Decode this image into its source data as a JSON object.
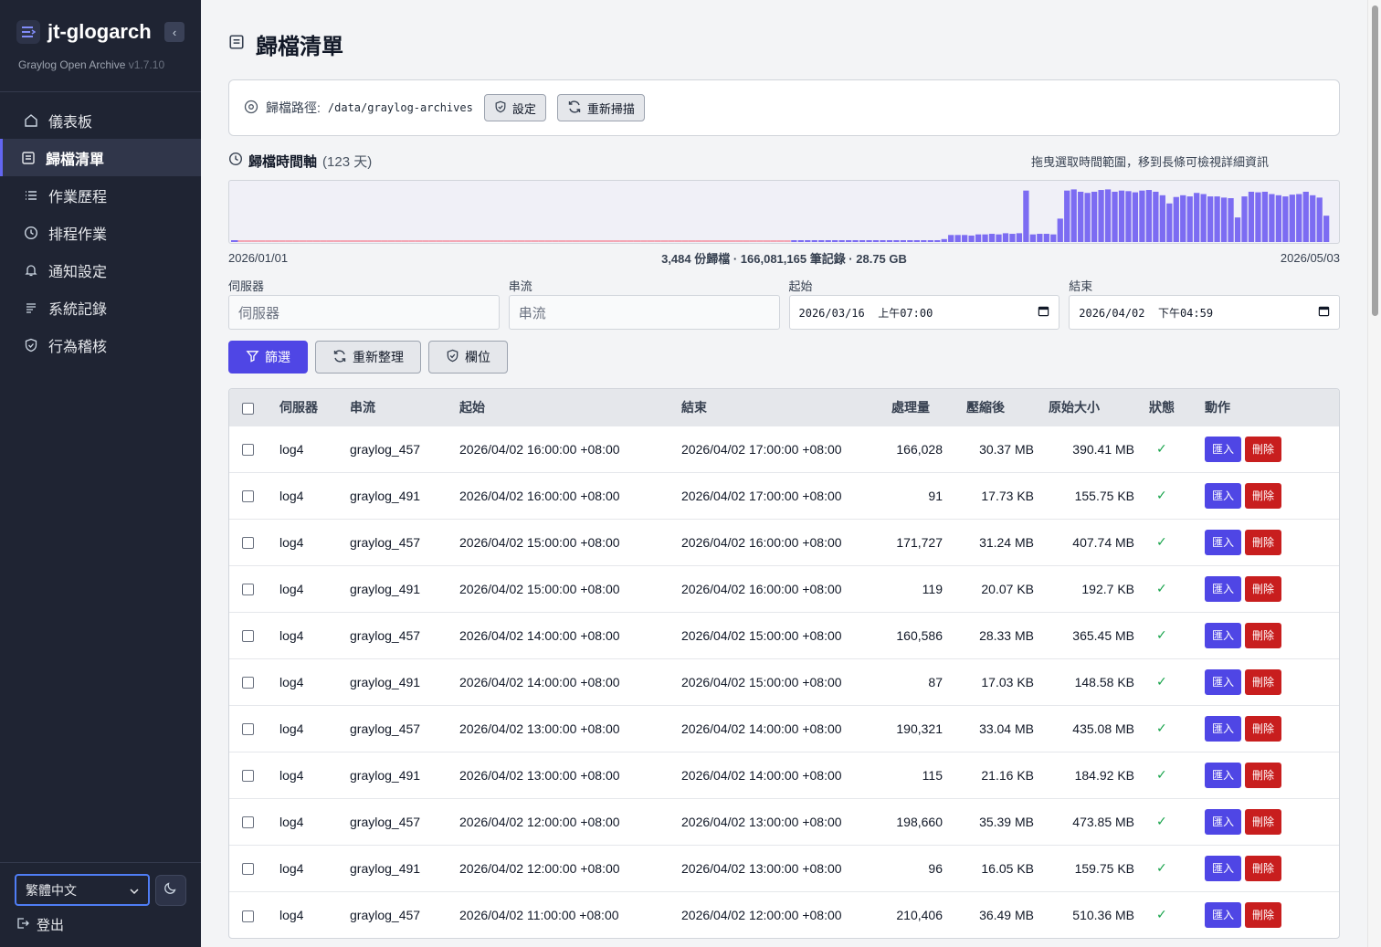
{
  "app": {
    "name": "jt-glogarch",
    "subtitle": "Graylog Open Archive",
    "version": "v1.7.10"
  },
  "sidebar": {
    "items": [
      {
        "label": "儀表板",
        "icon": "home-icon"
      },
      {
        "label": "歸檔清單",
        "icon": "archive-icon",
        "active": true
      },
      {
        "label": "作業歷程",
        "icon": "list-icon"
      },
      {
        "label": "排程作業",
        "icon": "clock-icon"
      },
      {
        "label": "通知設定",
        "icon": "bell-icon"
      },
      {
        "label": "系統記錄",
        "icon": "lines-icon"
      },
      {
        "label": "行為稽核",
        "icon": "shield-icon"
      }
    ],
    "language": "繁體中文",
    "logout": "登出"
  },
  "page": {
    "title": "歸檔清單"
  },
  "path_bar": {
    "label": "歸檔路徑:",
    "path": "/data/graylog-archives",
    "settings_btn": "設定",
    "rescan_btn": "重新掃描"
  },
  "timeline": {
    "title": "歸檔時間軸",
    "days": "(123 天)",
    "hint": "拖曳選取時間範圍，移到長條可檢視詳細資訊",
    "start_date": "2026/01/01",
    "end_date": "2026/05/03",
    "summary": "3,484 份歸檔 · 166,081,165 筆記錄 · 28.75 GB",
    "bar_color": "#7c6cf2",
    "empty_color": "#f4a6b4"
  },
  "chart_data": {
    "type": "bar",
    "x_range": [
      "2026/01/01",
      "2026/05/03"
    ],
    "values": [
      1,
      1,
      1,
      1,
      1,
      1,
      1,
      1,
      1,
      1,
      1,
      1,
      1,
      1,
      1,
      1,
      1,
      1,
      1,
      1,
      1,
      1,
      1,
      1,
      1,
      1,
      1,
      1,
      1,
      1,
      1,
      1,
      1,
      1,
      1,
      1,
      1,
      1,
      1,
      1,
      1,
      1,
      1,
      1,
      1,
      1,
      1,
      1,
      1,
      1,
      1,
      1,
      1,
      1,
      1,
      1,
      1,
      1,
      1,
      1,
      1,
      1,
      1,
      1,
      1,
      1,
      1,
      1,
      1,
      1,
      1,
      1,
      1,
      1,
      1,
      1,
      1,
      1,
      1,
      1,
      1,
      1,
      3,
      3,
      3,
      3,
      3,
      3,
      3,
      3,
      3,
      3,
      3,
      3,
      3,
      3,
      3,
      3,
      3,
      3,
      3,
      3,
      3,
      3,
      5,
      12,
      12,
      12,
      11,
      13,
      13,
      14,
      13,
      15,
      14,
      15,
      88,
      13,
      14,
      14,
      13,
      40,
      88,
      90,
      86,
      84,
      86,
      89,
      90,
      86,
      88,
      87,
      85,
      88,
      89,
      86,
      80,
      66,
      77,
      80,
      78,
      84,
      82,
      78,
      78,
      76,
      75,
      42,
      78,
      86,
      85,
      86,
      82,
      80,
      78,
      81,
      82,
      86,
      80,
      76,
      45
    ],
    "ylim": [
      0,
      100
    ]
  },
  "filters": {
    "server": {
      "label": "伺服器",
      "placeholder": "伺服器"
    },
    "stream": {
      "label": "串流",
      "placeholder": "串流"
    },
    "start": {
      "label": "起始",
      "value": "2026/03/16  上午07:00"
    },
    "end": {
      "label": "結束",
      "value": "2026/04/02  下午04:59"
    }
  },
  "buttons": {
    "filter": "篩選",
    "refresh": "重新整理",
    "columns": "欄位"
  },
  "table": {
    "headers": [
      "伺服器",
      "串流",
      "起始",
      "結束",
      "處理量",
      "壓縮後",
      "原始大小",
      "狀態",
      "動作"
    ],
    "import_label": "匯入",
    "delete_label": "刪除",
    "status_ok": "✓",
    "rows": [
      [
        "log4",
        "graylog_457",
        "2026/04/02 16:00:00 +08:00",
        "2026/04/02 17:00:00 +08:00",
        "166,028",
        "30.37 MB",
        "390.41 MB"
      ],
      [
        "log4",
        "graylog_491",
        "2026/04/02 16:00:00 +08:00",
        "2026/04/02 17:00:00 +08:00",
        "91",
        "17.73 KB",
        "155.75 KB"
      ],
      [
        "log4",
        "graylog_457",
        "2026/04/02 15:00:00 +08:00",
        "2026/04/02 16:00:00 +08:00",
        "171,727",
        "31.24 MB",
        "407.74 MB"
      ],
      [
        "log4",
        "graylog_491",
        "2026/04/02 15:00:00 +08:00",
        "2026/04/02 16:00:00 +08:00",
        "119",
        "20.07 KB",
        "192.7 KB"
      ],
      [
        "log4",
        "graylog_457",
        "2026/04/02 14:00:00 +08:00",
        "2026/04/02 15:00:00 +08:00",
        "160,586",
        "28.33 MB",
        "365.45 MB"
      ],
      [
        "log4",
        "graylog_491",
        "2026/04/02 14:00:00 +08:00",
        "2026/04/02 15:00:00 +08:00",
        "87",
        "17.03 KB",
        "148.58 KB"
      ],
      [
        "log4",
        "graylog_457",
        "2026/04/02 13:00:00 +08:00",
        "2026/04/02 14:00:00 +08:00",
        "190,321",
        "33.04 MB",
        "435.08 MB"
      ],
      [
        "log4",
        "graylog_491",
        "2026/04/02 13:00:00 +08:00",
        "2026/04/02 14:00:00 +08:00",
        "115",
        "21.16 KB",
        "184.92 KB"
      ],
      [
        "log4",
        "graylog_457",
        "2026/04/02 12:00:00 +08:00",
        "2026/04/02 13:00:00 +08:00",
        "198,660",
        "35.39 MB",
        "473.85 MB"
      ],
      [
        "log4",
        "graylog_491",
        "2026/04/02 12:00:00 +08:00",
        "2026/04/02 13:00:00 +08:00",
        "96",
        "16.05 KB",
        "159.75 KB"
      ],
      [
        "log4",
        "graylog_457",
        "2026/04/02 11:00:00 +08:00",
        "2026/04/02 12:00:00 +08:00",
        "210,406",
        "36.49 MB",
        "510.36 MB"
      ]
    ]
  }
}
